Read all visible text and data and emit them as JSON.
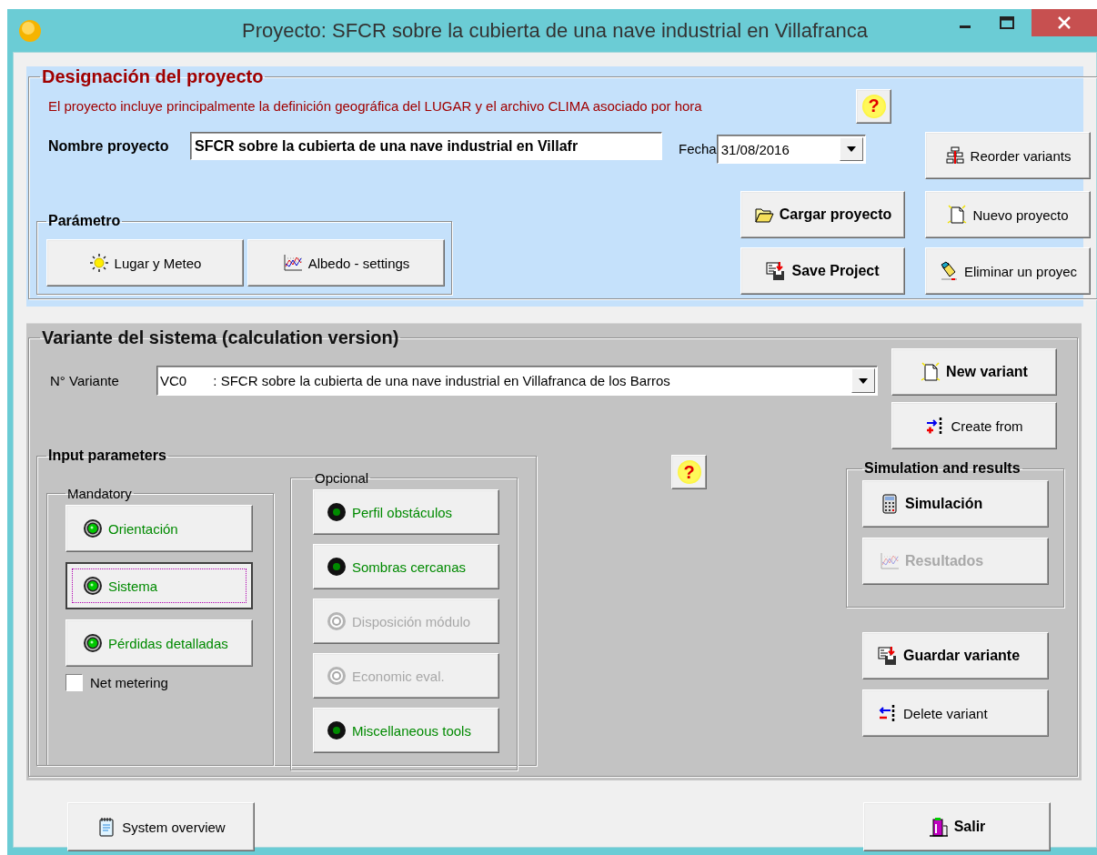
{
  "window": {
    "title": "Proyecto:  SFCR sobre la cubierta de una nave industrial en Villafranca"
  },
  "project": {
    "heading": "Designación del proyecto",
    "description": "El proyecto incluye principalmente la definición geográfica del LUGAR y el archivo CLIMA asociado por hora",
    "help": "?",
    "name_label": "Nombre proyecto",
    "name_value": "SFCR sobre la cubierta de una nave industrial en Villafr",
    "date_label": "Fecha",
    "date_value": "31/08/2016",
    "parameter": {
      "heading": "Parámetro",
      "buttons": [
        {
          "label": "Lugar y Meteo",
          "bold": false
        },
        {
          "label": "Albedo - settings",
          "bold": false
        }
      ]
    },
    "buttons": [
      {
        "label": "Reorder variants",
        "bold": false
      },
      {
        "label": "Cargar proyecto",
        "bold": true
      },
      {
        "label": "Nuevo proyecto",
        "bold": false
      },
      {
        "label": "Save Project",
        "bold": true
      },
      {
        "label": "Eliminar un proyec",
        "bold": false
      }
    ]
  },
  "variant": {
    "heading": "Variante del sistema (calculation version)",
    "number_label": "N° Variante",
    "number_value": "VC0       : SFCR sobre la cubierta de una nave industrial en Villafranca de los Barros",
    "buttons": [
      {
        "label": "New variant",
        "bold": true
      },
      {
        "label": "Create from",
        "bold": false
      }
    ],
    "input": {
      "heading": "Input parameters",
      "mandatory": {
        "heading": "Mandatory",
        "items": [
          {
            "label": "Orientación",
            "complete": true,
            "disabled": false,
            "focused": false
          },
          {
            "label": "Sistema",
            "complete": true,
            "disabled": false,
            "focused": true
          },
          {
            "label": "Pérdidas detalladas",
            "complete": true,
            "disabled": false,
            "focused": false
          }
        ],
        "net_metering": {
          "label": "Net metering",
          "checked": false
        }
      },
      "optional": {
        "heading": "Opcional",
        "items": [
          {
            "label": "Perfil obstáculos",
            "complete": false,
            "disabled": false
          },
          {
            "label": "Sombras cercanas",
            "complete": false,
            "disabled": false
          },
          {
            "label": "Disposición módulo",
            "complete": false,
            "disabled": true
          },
          {
            "label": "Economic eval.",
            "complete": false,
            "disabled": true
          },
          {
            "label": "Miscellaneous tools",
            "complete": false,
            "disabled": false
          }
        ]
      }
    },
    "help": "?",
    "simulation": {
      "heading": "Simulation and results",
      "buttons": [
        {
          "label": "Simulación",
          "bold": true,
          "disabled": false
        },
        {
          "label": "Resultados",
          "bold": true,
          "disabled": true
        }
      ]
    },
    "actions": [
      {
        "label": "Guardar variante",
        "bold": true
      },
      {
        "label": "Delete variant",
        "bold": false
      }
    ]
  },
  "footer": [
    {
      "label": "System overview",
      "bold": false
    },
    {
      "label": "Salir",
      "bold": true
    }
  ]
}
